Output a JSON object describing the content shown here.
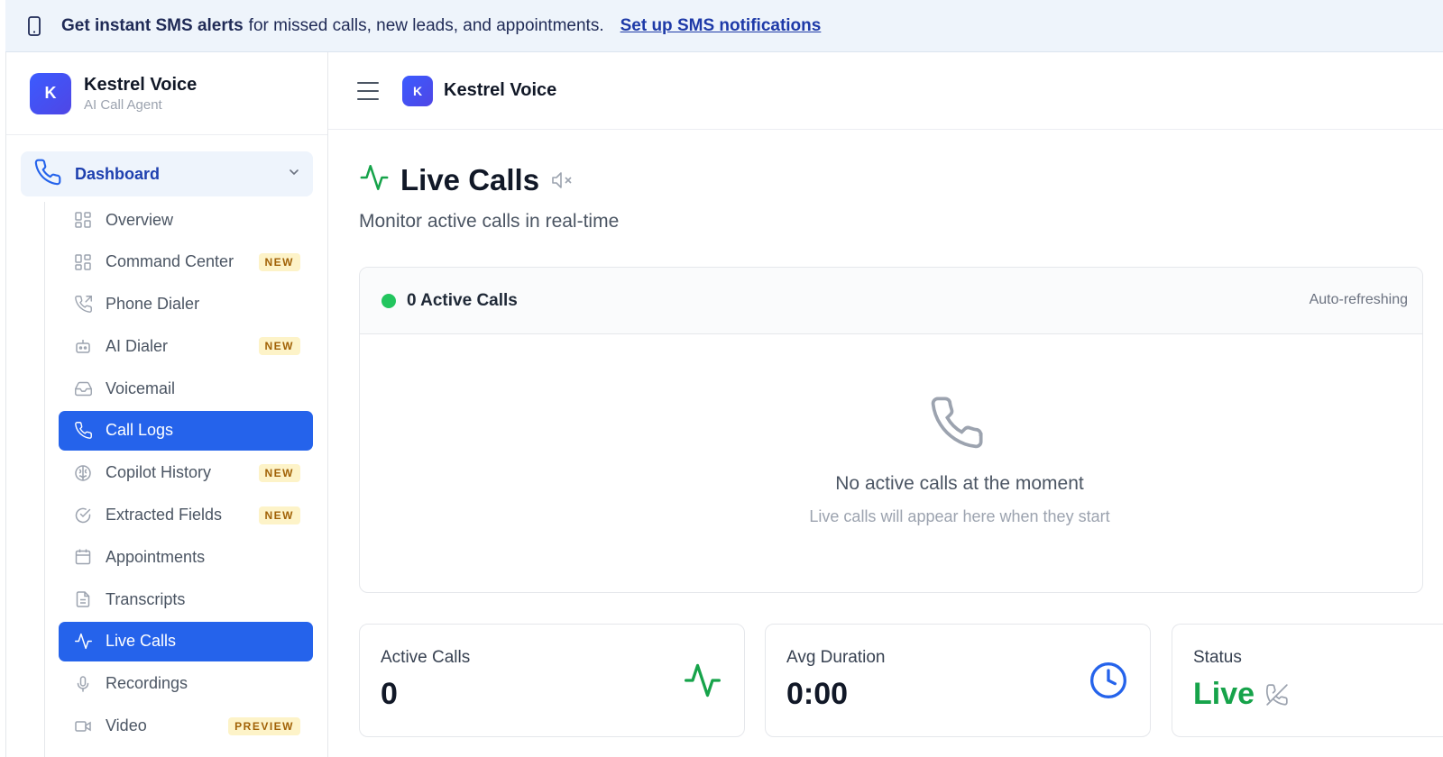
{
  "banner": {
    "strong": "Get instant SMS alerts",
    "text": "for missed calls, new leads, and appointments.",
    "link": "Set up SMS notifications"
  },
  "brand": {
    "initial": "K",
    "name": "Kestrel Voice",
    "subtitle": "AI Call Agent"
  },
  "section": {
    "label": "Dashboard"
  },
  "nav": [
    {
      "label": "Overview",
      "icon": "grid-icon",
      "badge": ""
    },
    {
      "label": "Command Center",
      "icon": "grid-icon",
      "badge": "NEW"
    },
    {
      "label": "Phone Dialer",
      "icon": "phone-outgoing-icon",
      "badge": ""
    },
    {
      "label": "AI Dialer",
      "icon": "bot-icon",
      "badge": "NEW"
    },
    {
      "label": "Voicemail",
      "icon": "inbox-icon",
      "badge": ""
    },
    {
      "label": "Call Logs",
      "icon": "phone-icon",
      "badge": ""
    },
    {
      "label": "Copilot History",
      "icon": "brain-icon",
      "badge": "NEW"
    },
    {
      "label": "Extracted Fields",
      "icon": "check-circle-icon",
      "badge": "NEW"
    },
    {
      "label": "Appointments",
      "icon": "calendar-icon",
      "badge": ""
    },
    {
      "label": "Transcripts",
      "icon": "file-text-icon",
      "badge": ""
    },
    {
      "label": "Live Calls",
      "icon": "activity-icon",
      "badge": ""
    },
    {
      "label": "Recordings",
      "icon": "mic-icon",
      "badge": ""
    },
    {
      "label": "Video",
      "icon": "video-icon",
      "badge": "PREVIEW"
    }
  ],
  "topbar": {
    "initial": "K",
    "name": "Kestrel Voice"
  },
  "page": {
    "title": "Live Calls",
    "subtitle": "Monitor active calls in real-time"
  },
  "panel": {
    "count_label": "0 Active Calls",
    "auto": "Auto-refreshing",
    "empty_title": "No active calls at the moment",
    "empty_hint": "Live calls will appear here when they start"
  },
  "cards": {
    "active": {
      "label": "Active Calls",
      "value": "0"
    },
    "duration": {
      "label": "Avg Duration",
      "value": "0:00"
    },
    "status": {
      "label": "Status",
      "value": "Live"
    }
  },
  "colors": {
    "accent": "#2563eb",
    "green": "#16a34a",
    "badge_bg": "#fdf3c8"
  }
}
